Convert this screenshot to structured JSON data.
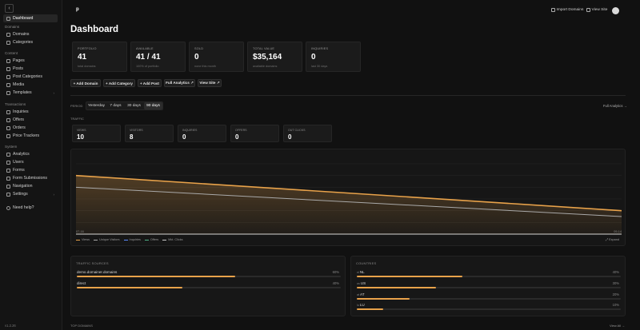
{
  "colors": {
    "accent": "#e8a24a",
    "secondary_line": "#a9a9a9",
    "background": "#111111"
  },
  "sidebar": {
    "collapse_icon": "chevron-left-icon",
    "dashboard": "Dashboard",
    "sections": {
      "domains": "Domains",
      "content": "Content",
      "transactions": "Transactions",
      "system": "System"
    },
    "domains_items": [
      "Domains",
      "Categories"
    ],
    "content_items": [
      "Pages",
      "Posts",
      "Post Categories",
      "Media",
      "Templates"
    ],
    "transactions_items": [
      "Inquiries",
      "Offers",
      "Orders",
      "Price Trackers"
    ],
    "system_items": [
      "Analytics",
      "Users",
      "Forms",
      "Form Submissions",
      "Navigation",
      "Settings"
    ],
    "help": "Need help?",
    "version": "v1.2.26"
  },
  "header": {
    "logo": "p",
    "import_domains": "Import Domains",
    "view_site": "View Site"
  },
  "page_title": "Dashboard",
  "stats": [
    {
      "label": "PORTFOLIO",
      "value": "41",
      "sub": "total domains"
    },
    {
      "label": "AVAILABLE",
      "value": "41 / 41",
      "sub": "100% of portfolio"
    },
    {
      "label": "SOLD",
      "value": "0",
      "sub": "none this month"
    },
    {
      "label": "TOTAL VALUE",
      "value": "$35,164",
      "sub": "available domains"
    },
    {
      "label": "INQUIRIES",
      "value": "0",
      "sub": "last 30 days"
    }
  ],
  "actions": [
    "+ Add Domain",
    "+ Add Category",
    "+ Add Post",
    "Full Analytics ↗",
    "View Site ↗"
  ],
  "period": {
    "label": "PERIOD",
    "options": [
      "Yesterday",
      "7 days",
      "30 days",
      "90 days"
    ],
    "selected": "90 days",
    "full_analytics": "Full Analytics →"
  },
  "traffic": {
    "label": "TRAFFIC",
    "cards": [
      {
        "label": "VIEWS",
        "value": "10"
      },
      {
        "label": "VISITORS",
        "value": "8"
      },
      {
        "label": "INQUIRIES",
        "value": "0"
      },
      {
        "label": "OFFERS",
        "value": "0"
      },
      {
        "label": "OUT CLICKS",
        "value": "0"
      }
    ]
  },
  "chart_data": {
    "type": "area",
    "x_labels": [
      "07-16",
      "09-14"
    ],
    "series": [
      {
        "name": "Views",
        "color": "#e8a24a",
        "values": [
          10,
          4
        ]
      },
      {
        "name": "Unique Visitors",
        "color": "#a9a9a9",
        "values": [
          8,
          3
        ]
      },
      {
        "name": "Inquiries",
        "color": "#5b8cff",
        "values": [
          0,
          0
        ]
      },
      {
        "name": "Offers",
        "color": "#4fb286",
        "values": [
          0,
          0
        ]
      },
      {
        "name": "Mkt. Clicks",
        "color": "#c8c8c8",
        "values": [
          0,
          0
        ]
      }
    ],
    "legend_position": "bottom-left",
    "expand_label": "⤢ Expand"
  },
  "traffic_sources": {
    "title": "TRAFFIC SOURCES",
    "rows": [
      {
        "name": "demo.domainer.domains",
        "pct_label": "60%",
        "pct": 0.6
      },
      {
        "name": "direct",
        "pct_label": "40%",
        "pct": 0.4
      }
    ]
  },
  "countries": {
    "title": "COUNTRIES",
    "rows": [
      {
        "name": "NL",
        "flag": "nl",
        "pct_label": "40%",
        "pct": 0.4
      },
      {
        "name": "US",
        "flag": "us",
        "pct_label": "30%",
        "pct": 0.3
      },
      {
        "name": "AT",
        "flag": "at",
        "pct_label": "20%",
        "pct": 0.2
      },
      {
        "name": "LU",
        "flag": "lu",
        "pct_label": "10%",
        "pct": 0.1
      }
    ]
  },
  "top_domains": {
    "title": "TOP DOMAINS",
    "view_all": "View All →"
  }
}
